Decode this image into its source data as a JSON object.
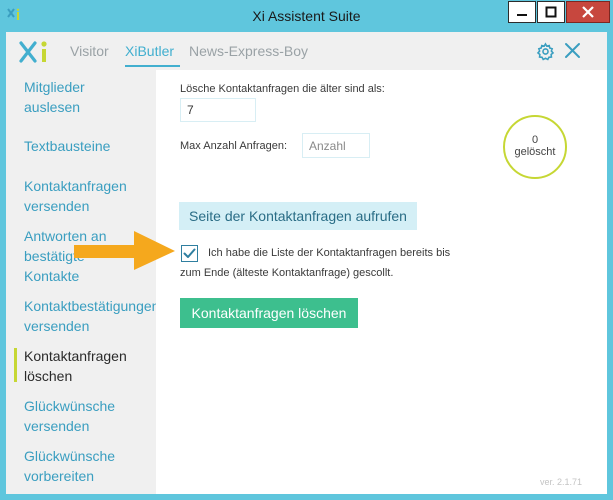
{
  "window": {
    "title": "Xi Assistent Suite"
  },
  "tabs": [
    {
      "label": "Visitor"
    },
    {
      "label": "XiButler"
    },
    {
      "label": "News-Express-Boy"
    }
  ],
  "active_tab": "XiButler",
  "sidebar": {
    "items": [
      {
        "line1": "Mitglieder",
        "line2": "auslesen"
      },
      {
        "line1": "Textbausteine",
        "line2": ""
      },
      {
        "line1": "Kontaktanfragen",
        "line2": "versenden"
      },
      {
        "line1": "Antworten an",
        "line2": "bestätigte",
        "line3": "Kontakte"
      },
      {
        "line1": "Kontaktbestätigungen",
        "line2": "versenden"
      },
      {
        "line1": "Kontaktanfragen",
        "line2": "löschen"
      },
      {
        "line1": "Glückwünsche",
        "line2": "versenden"
      },
      {
        "line1": "Glückwünsche",
        "line2": "vorbereiten"
      }
    ],
    "active_index": 5
  },
  "content": {
    "older_than_label": "Lösche Kontaktanfragen die älter sind als:",
    "older_than_value": "7",
    "max_requests_label": "Max Anzahl Anfragen:",
    "max_requests_placeholder": "Anzahl",
    "open_page_button": "Seite der Kontaktanfragen aufrufen",
    "checkbox_checked": true,
    "checkbox_line1": "Ich habe die Liste der Kontaktanfragen bereits bis",
    "checkbox_line2": "zum Ende (älteste Kontaktanfrage) gescollt.",
    "delete_button": "Kontaktanfragen löschen",
    "counter_value": "0",
    "counter_label": "gelöscht",
    "version": "ver. 2.1.71"
  },
  "colors": {
    "frame": "#5fc6dd",
    "accent": "#42afcf",
    "green_button": "#3dbf8e",
    "counter_ring": "#c6d734",
    "arrow": "#f5a81d"
  },
  "icons": [
    "xi-app-icon",
    "minimize-icon",
    "maximize-icon",
    "close-icon",
    "xi-logo",
    "gear-icon",
    "close-x-icon",
    "check-icon",
    "arrow-annotation"
  ]
}
